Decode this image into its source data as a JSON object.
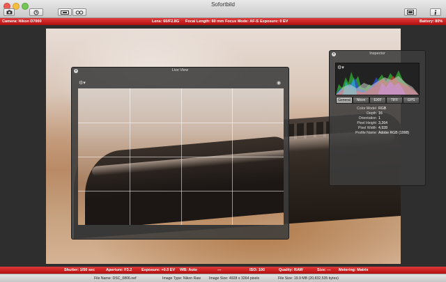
{
  "window": {
    "title": "Sofortbild"
  },
  "toolbar": {
    "buttons": [
      {
        "name": "camera-button",
        "icon": "camera-icon"
      },
      {
        "name": "timer-button",
        "icon": "timer-icon"
      },
      {
        "name": "bracket-button",
        "icon": "bracket-icon"
      },
      {
        "name": "focus-button",
        "icon": "focus-icon"
      },
      {
        "name": "panel-toggle-button",
        "icon": "panel-icon"
      },
      {
        "name": "info-button",
        "icon": "info-icon"
      }
    ]
  },
  "status_top": {
    "camera": "Camera: Nikon D7000",
    "lens": "Lens: 60/F2.8G",
    "focal": "Focal Length: 60 mm",
    "focus": "Focus Mode: AF-S",
    "exposure": "Exposure: 0 EV",
    "battery": "Battery: 80%"
  },
  "live_view": {
    "title": "Live View"
  },
  "inspector": {
    "title": "Inspector",
    "tabs": [
      "General",
      "Nikon",
      "EXIF",
      "TIFF",
      "GPS"
    ],
    "active_tab": "General",
    "properties": [
      {
        "key": "Color Model",
        "value": "RGB"
      },
      {
        "key": "Depth",
        "value": "16"
      },
      {
        "key": "Orientation",
        "value": "1"
      },
      {
        "key": "Pixel Height",
        "value": "3,264"
      },
      {
        "key": "Pixel Width",
        "value": "4,928"
      },
      {
        "key": "Profile Name",
        "value": "Adobe RGB (1998)"
      }
    ]
  },
  "status_bottom": {
    "shutter": "Shutter: 1/50 sec",
    "aperture": "Aperture: F3.2",
    "exposure": "Exposure: +0.0 EV",
    "wb": "WB: Auto",
    "dash": "---",
    "iso": "ISO: 100",
    "quality": "Quality: RAW",
    "size": "Size: ---",
    "metering": "Metering: Matrix"
  },
  "file_info": {
    "name": "File Name: DSC_0806.nef",
    "type": "Image Type: Nikon Raw",
    "dims": "Image Size: 4928 x 3264 pixels",
    "size": "File Size: 19.9 MB (20,832,535 bytes)"
  },
  "colors": {
    "accent_red": "#c81d1d"
  }
}
